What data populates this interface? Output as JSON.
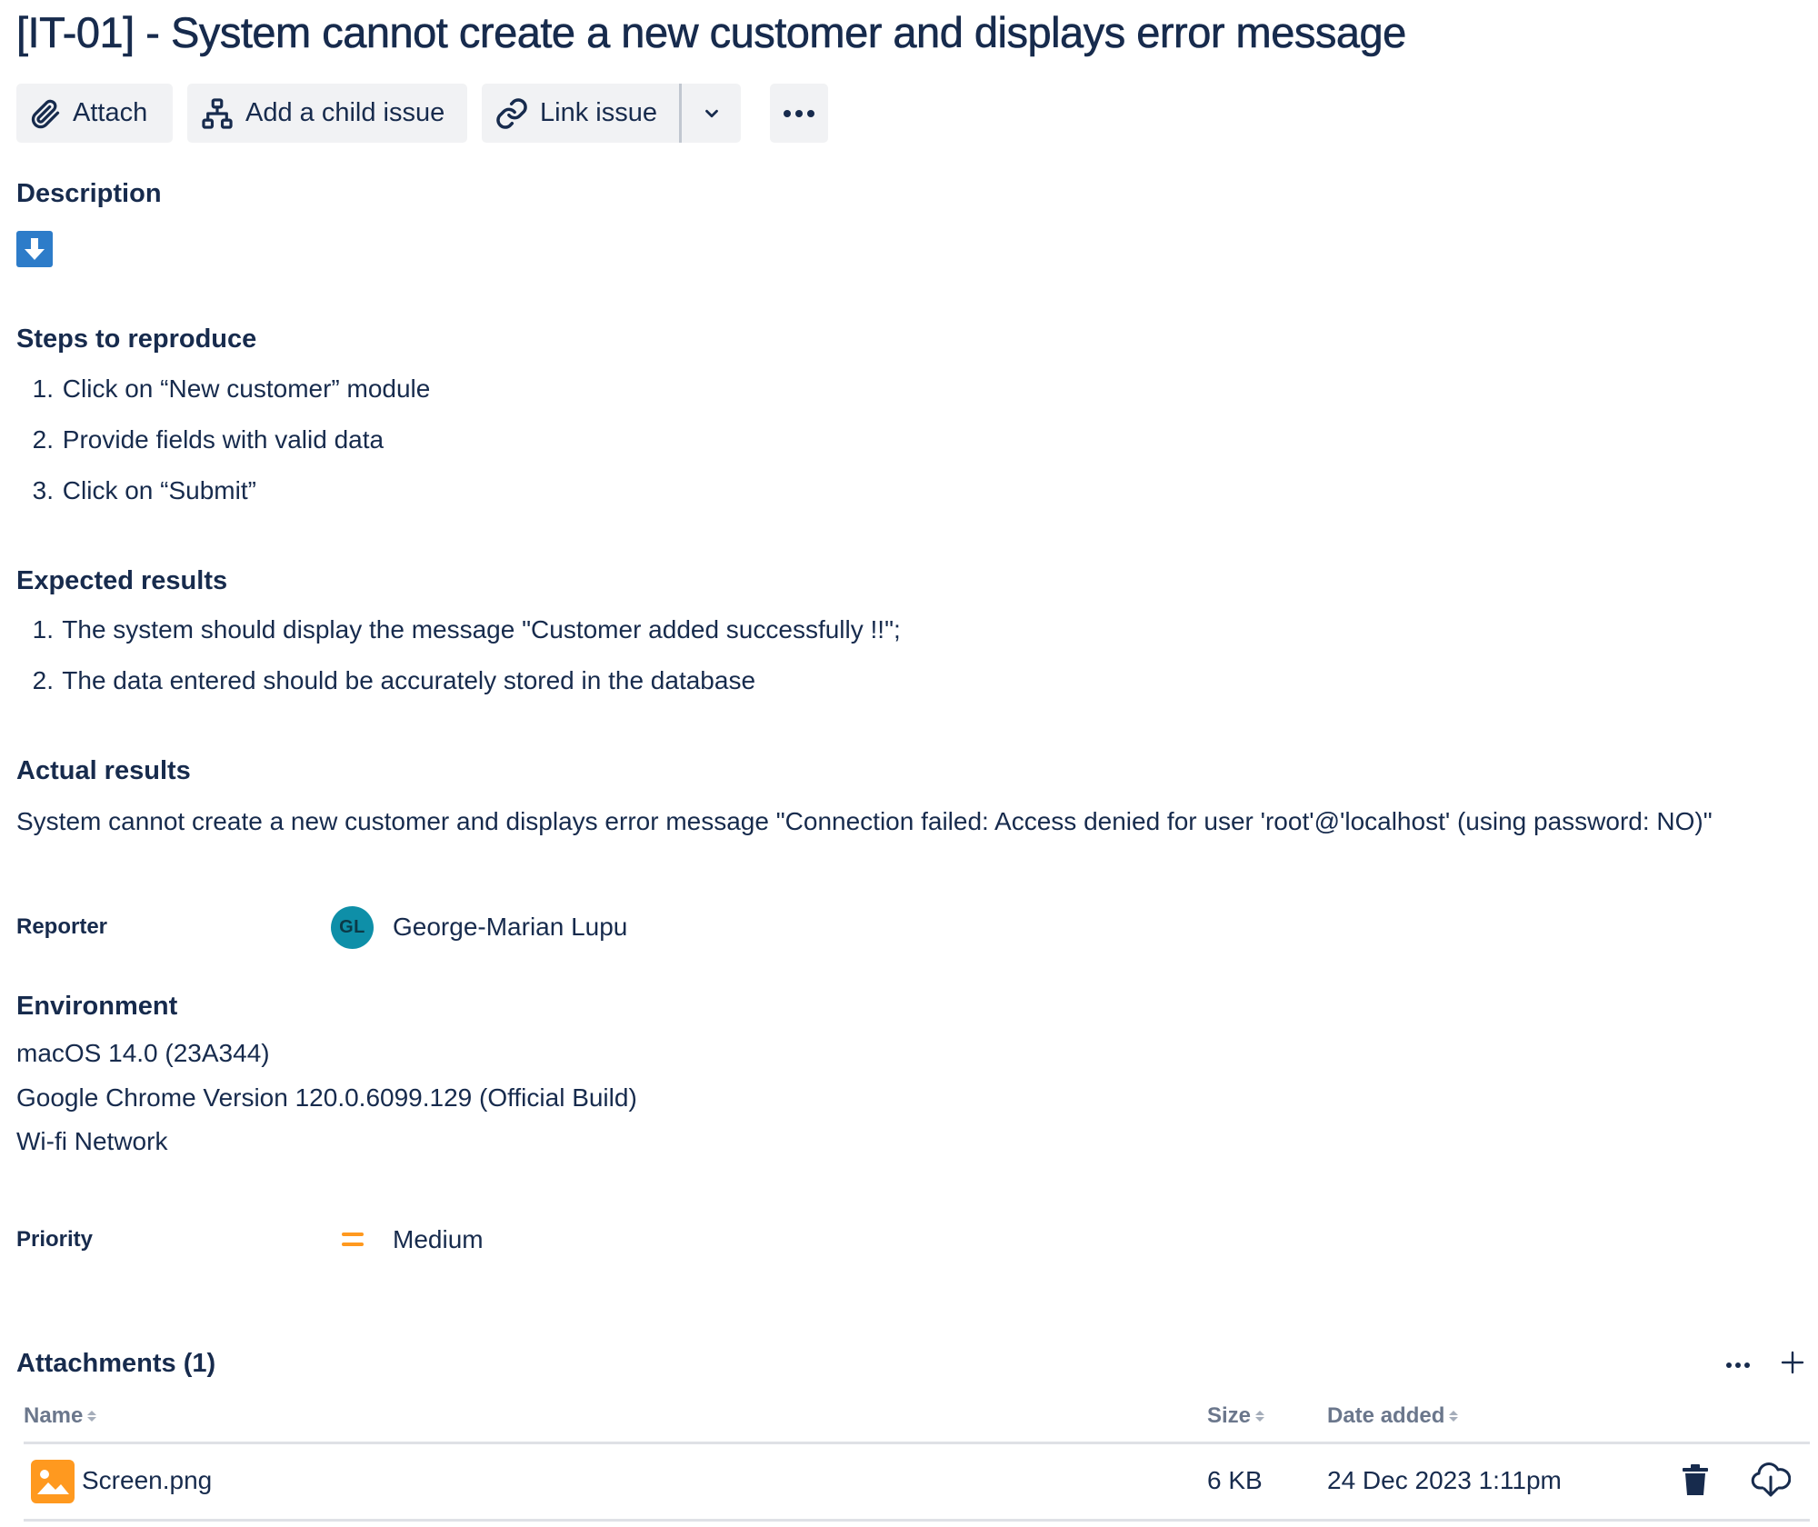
{
  "issue": {
    "title": "[IT-01] - System cannot create a new customer and displays error message"
  },
  "toolbar": {
    "attach_label": "Attach",
    "child_issue_label": "Add a child issue",
    "link_issue_label": "Link issue",
    "icons": [
      "paperclip-icon",
      "hierarchy-icon",
      "link-icon",
      "chevron-down-icon",
      "more-icon"
    ]
  },
  "description": {
    "heading": "Description",
    "badge_icon": "arrow-down-icon",
    "badge_color": "#2d7cc9",
    "steps": {
      "heading": "Steps to reproduce",
      "items": [
        "Click on “New customer” module",
        "Provide fields with valid data",
        "Click on “Submit”"
      ]
    },
    "expected": {
      "heading": "Expected results",
      "items": [
        "The system should display the message \"Customer added successfully !!\";",
        "The data entered should be accurately stored in the database"
      ]
    },
    "actual": {
      "heading": "Actual results",
      "text": "System cannot create a new customer and displays error message \"Connection failed: Access denied for user 'root'@'localhost' (using password: NO)\""
    }
  },
  "reporter": {
    "label": "Reporter",
    "initials": "GL",
    "name": "George-Marian Lupu",
    "avatar_color": "#0e8fa8"
  },
  "environment": {
    "heading": "Environment",
    "lines": [
      "macOS 14.0 (23A344)",
      "Google Chrome Version 120.0.6099.129 (Official Build)",
      "Wi-fi Network"
    ]
  },
  "priority": {
    "label": "Priority",
    "value": "Medium",
    "icon": "priority-medium-icon",
    "color": "#ff991f"
  },
  "attachments": {
    "heading": "Attachments (1)",
    "columns": [
      "Name",
      "Size",
      "Date added"
    ],
    "rows": [
      {
        "name": "Screen.png",
        "size": "6 KB",
        "date": "24 Dec 2023 1:11pm",
        "icon": "image-file-icon",
        "icon_color": "#ff991f"
      }
    ]
  }
}
